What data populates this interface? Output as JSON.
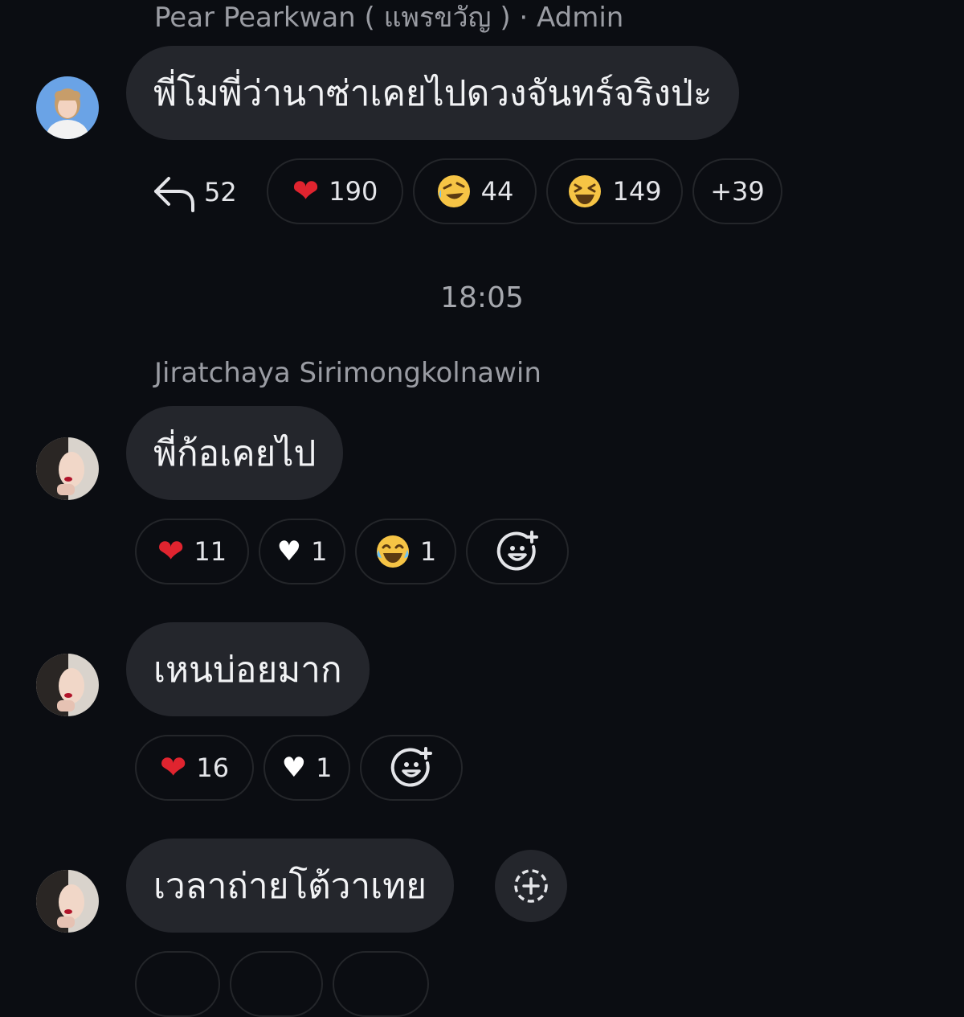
{
  "messages": [
    {
      "sender": "Pear Pearkwan ( แพรขวัญ ) · Admin",
      "text": "พี่โมพี่ว่านาซ่าเคยไปดวงจันทร์จริงป่ะ",
      "reply_count": "52",
      "reactions": [
        {
          "icon": "red-heart-icon",
          "count": "190"
        },
        {
          "icon": "rofl-face-icon",
          "count": "44"
        },
        {
          "icon": "laughing-face-icon",
          "count": "149"
        }
      ],
      "more_reactions": "+39"
    }
  ],
  "timestamp": "18:05",
  "thread": {
    "sender": "Jiratchaya Sirimongkolnawin",
    "items": [
      {
        "text": "พี่ก้อเคยไป",
        "reactions": [
          {
            "icon": "red-heart-icon",
            "count": "11"
          },
          {
            "icon": "white-heart-icon",
            "count": "1"
          },
          {
            "icon": "tears-of-joy-icon",
            "count": "1"
          }
        ]
      },
      {
        "text": "เหนบ่อยมาก",
        "reactions": [
          {
            "icon": "red-heart-icon",
            "count": "16"
          },
          {
            "icon": "white-heart-icon",
            "count": "1"
          }
        ]
      },
      {
        "text": "เวลาถ่ายโต้วาเทย"
      }
    ]
  },
  "colors": {
    "background": "#0b0d12",
    "bubble": "#24262c",
    "muted_text": "#9a9ca3",
    "heart_red": "#e0242f"
  }
}
